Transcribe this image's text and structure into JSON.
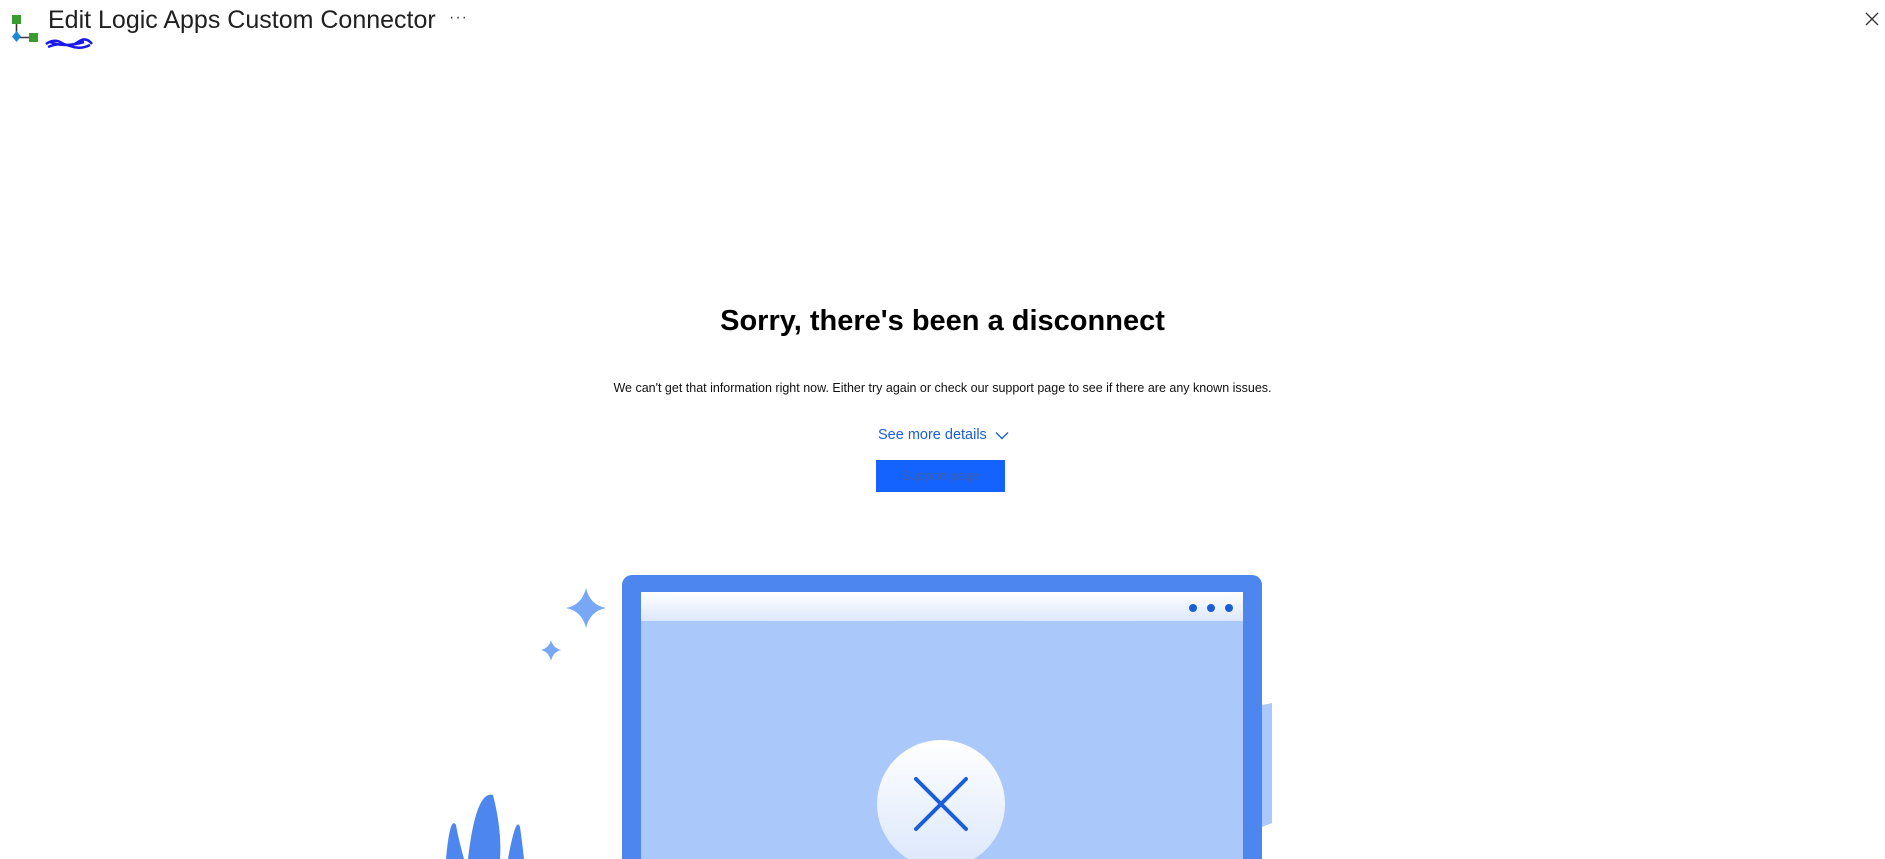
{
  "header": {
    "title": "Edit Logic Apps Custom Connector",
    "more_label": "···",
    "icons": {
      "logo": "logic-app-connector-icon",
      "close": "close-icon"
    }
  },
  "error": {
    "title": "Sorry, there's been a disconnect",
    "description": "We can't get that information right now. Either try again or check our support page to see if there are any known issues.",
    "details_label": "See more details",
    "support_button_label": "Support page"
  },
  "colors": {
    "accent": "#1463ff",
    "link": "#1a5fd9",
    "illustration_frame": "#4c86ee",
    "illustration_screen": "#abc8fb"
  }
}
